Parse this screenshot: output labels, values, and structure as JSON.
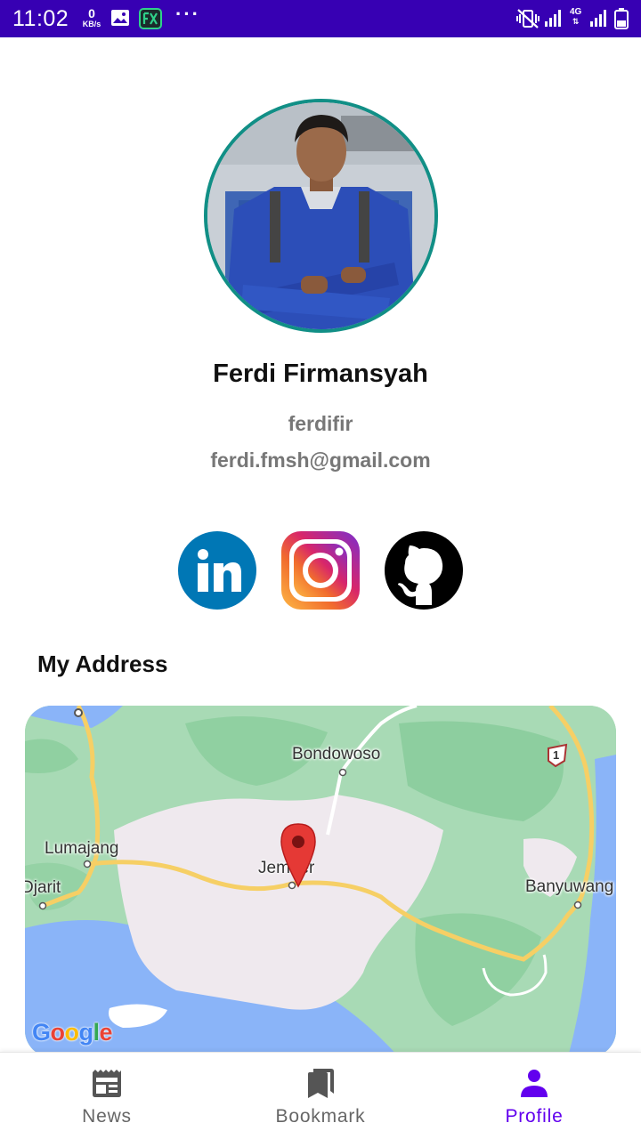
{
  "status_bar": {
    "time": "11:02",
    "net_speed_value": "0",
    "net_speed_unit": "KB/s",
    "network_type": "4G",
    "background_color": "#3700b3"
  },
  "profile": {
    "name": "Ferdi Firmansyah",
    "username": "ferdifir",
    "email": "ferdi.fmsh@gmail.com",
    "avatar_border_color": "#118f86"
  },
  "social_links": [
    {
      "icon": "linkedin-icon",
      "color": "#0077b5"
    },
    {
      "icon": "instagram-icon",
      "color": "#c13584"
    },
    {
      "icon": "github-icon",
      "color": "#000000"
    }
  ],
  "address": {
    "title": "My Address",
    "map": {
      "labels": {
        "bondowoso": "Bondowoso",
        "lumajang": "Lumajang",
        "jember": "Jember",
        "djarit": "Djarit",
        "banyuwangi": "Banyuwang",
        "route_shield": "1"
      },
      "attribution": "Google",
      "marker_color": "#e53935"
    }
  },
  "bottom_nav": {
    "items": [
      {
        "label": "News",
        "icon": "newspaper-icon",
        "active": false
      },
      {
        "label": "Bookmark",
        "icon": "bookmarks-icon",
        "active": false
      },
      {
        "label": "Profile",
        "icon": "person-icon",
        "active": true
      }
    ],
    "active_color": "#6200ee",
    "inactive_color": "#666666"
  }
}
